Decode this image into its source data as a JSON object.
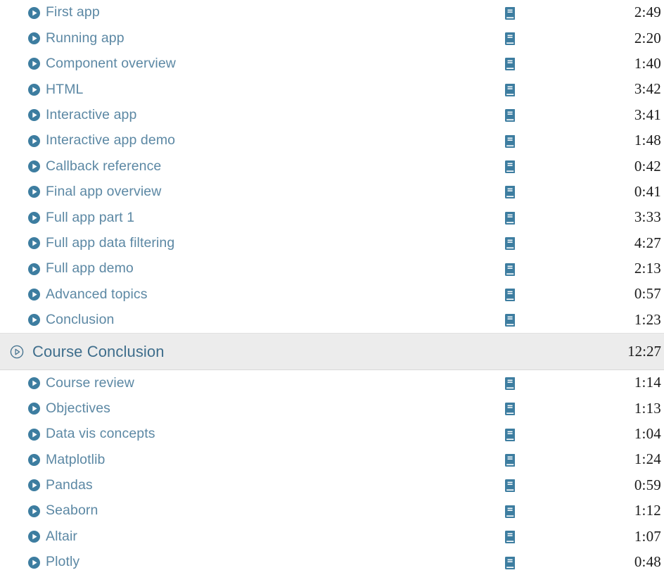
{
  "colors": {
    "accent_blue": "#3d7da0",
    "title_blue": "#5c88a4",
    "section_title_blue": "#3f6e8c",
    "duration_text": "#1a1a1a",
    "section_background": "#ececec",
    "page_background": "#ffffff"
  },
  "icons": {
    "lecture": "play-circle-filled-icon",
    "resource": "book-icon",
    "section": "play-circle-outline-icon"
  },
  "curriculum": {
    "top_lectures": [
      {
        "title": "First app",
        "duration": "2:49",
        "has_resource": true
      },
      {
        "title": "Running app",
        "duration": "2:20",
        "has_resource": true
      },
      {
        "title": "Component overview",
        "duration": "1:40",
        "has_resource": true
      },
      {
        "title": "HTML",
        "duration": "3:42",
        "has_resource": true
      },
      {
        "title": "Interactive app",
        "duration": "3:41",
        "has_resource": true
      },
      {
        "title": "Interactive app demo",
        "duration": "1:48",
        "has_resource": true
      },
      {
        "title": "Callback reference",
        "duration": "0:42",
        "has_resource": true
      },
      {
        "title": "Final app overview",
        "duration": "0:41",
        "has_resource": true
      },
      {
        "title": "Full app part 1",
        "duration": "3:33",
        "has_resource": true
      },
      {
        "title": "Full app data filtering",
        "duration": "4:27",
        "has_resource": true
      },
      {
        "title": "Full app demo",
        "duration": "2:13",
        "has_resource": true
      },
      {
        "title": "Advanced topics",
        "duration": "0:57",
        "has_resource": true
      },
      {
        "title": "Conclusion",
        "duration": "1:23",
        "has_resource": true
      }
    ],
    "section": {
      "title": "Course Conclusion",
      "duration": "12:27"
    },
    "section_lectures": [
      {
        "title": "Course review",
        "duration": "1:14",
        "has_resource": true
      },
      {
        "title": "Objectives",
        "duration": "1:13",
        "has_resource": true
      },
      {
        "title": "Data vis concepts",
        "duration": "1:04",
        "has_resource": true
      },
      {
        "title": "Matplotlib",
        "duration": "1:24",
        "has_resource": true
      },
      {
        "title": "Pandas",
        "duration": "0:59",
        "has_resource": true
      },
      {
        "title": "Seaborn",
        "duration": "1:12",
        "has_resource": true
      },
      {
        "title": "Altair",
        "duration": "1:07",
        "has_resource": true
      },
      {
        "title": "Plotly",
        "duration": "0:48",
        "has_resource": true
      }
    ]
  }
}
